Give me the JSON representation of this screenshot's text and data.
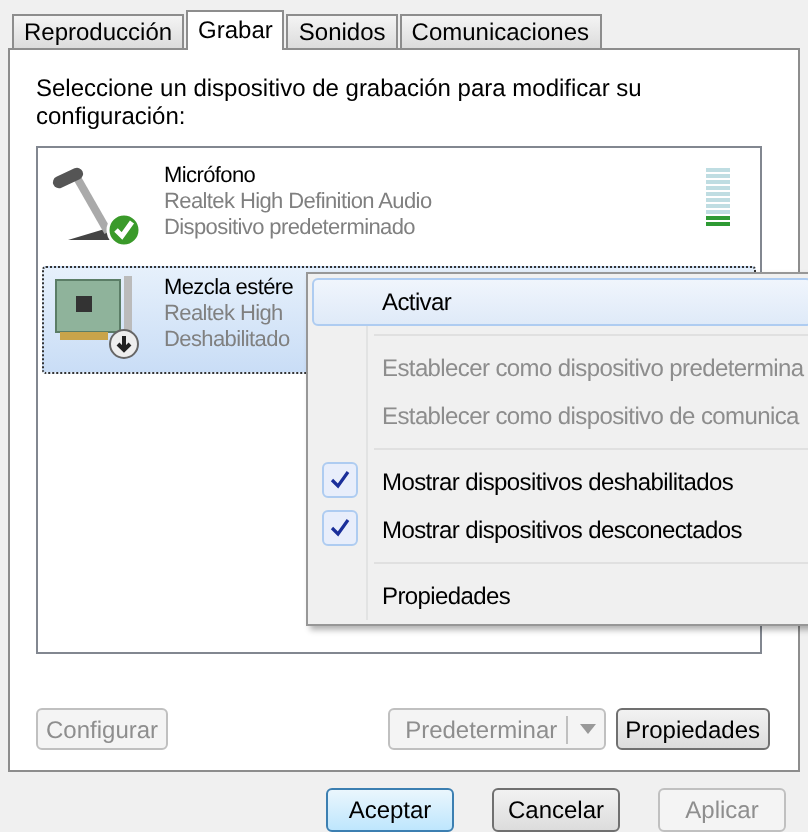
{
  "tabs": [
    {
      "label": "Reproducción",
      "selected": false
    },
    {
      "label": "Grabar",
      "selected": true
    },
    {
      "label": "Sonidos",
      "selected": false
    },
    {
      "label": "Comunicaciones",
      "selected": false
    }
  ],
  "instruction": "Seleccione un dispositivo de grabación para modificar su configuración:",
  "devices": [
    {
      "kind": "microphone",
      "name": "Micrófono",
      "driver": "Realtek High Definition Audio",
      "status": "Dispositivo predeterminado",
      "is_default": true,
      "disabled": false,
      "selected": false,
      "level": 0.2
    },
    {
      "kind": "card",
      "name": "Mezcla estére",
      "driver": "Realtek High",
      "status": "Deshabilitado",
      "is_default": false,
      "disabled": true,
      "selected": true
    }
  ],
  "context_menu": [
    {
      "kind": "item",
      "label": "Activar",
      "disabled": false,
      "checked": false,
      "selected": true
    },
    {
      "kind": "separator"
    },
    {
      "kind": "item",
      "label": "Establecer como dispositivo predetermina",
      "disabled": true,
      "checked": false,
      "selected": false
    },
    {
      "kind": "item",
      "label": "Establecer como dispositivo de comunica",
      "disabled": true,
      "checked": false,
      "selected": false
    },
    {
      "kind": "separator"
    },
    {
      "kind": "item",
      "label": "Mostrar dispositivos deshabilitados",
      "disabled": false,
      "checked": true,
      "selected": false
    },
    {
      "kind": "item",
      "label": "Mostrar dispositivos desconectados",
      "disabled": false,
      "checked": true,
      "selected": false
    },
    {
      "kind": "separator"
    },
    {
      "kind": "item",
      "label": "Propiedades",
      "disabled": false,
      "checked": false,
      "selected": false
    }
  ],
  "panel_buttons": {
    "configure": {
      "label": "Configurar",
      "disabled": true
    },
    "default": {
      "label": "Predeterminar",
      "disabled": true
    },
    "properties": {
      "label": "Propiedades",
      "disabled": false
    }
  },
  "dialog_buttons": [
    {
      "label": "Aceptar",
      "disabled": false,
      "focused": true
    },
    {
      "label": "Cancelar",
      "disabled": false,
      "focused": false
    },
    {
      "label": "Aplicar",
      "disabled": true,
      "focused": false
    }
  ]
}
